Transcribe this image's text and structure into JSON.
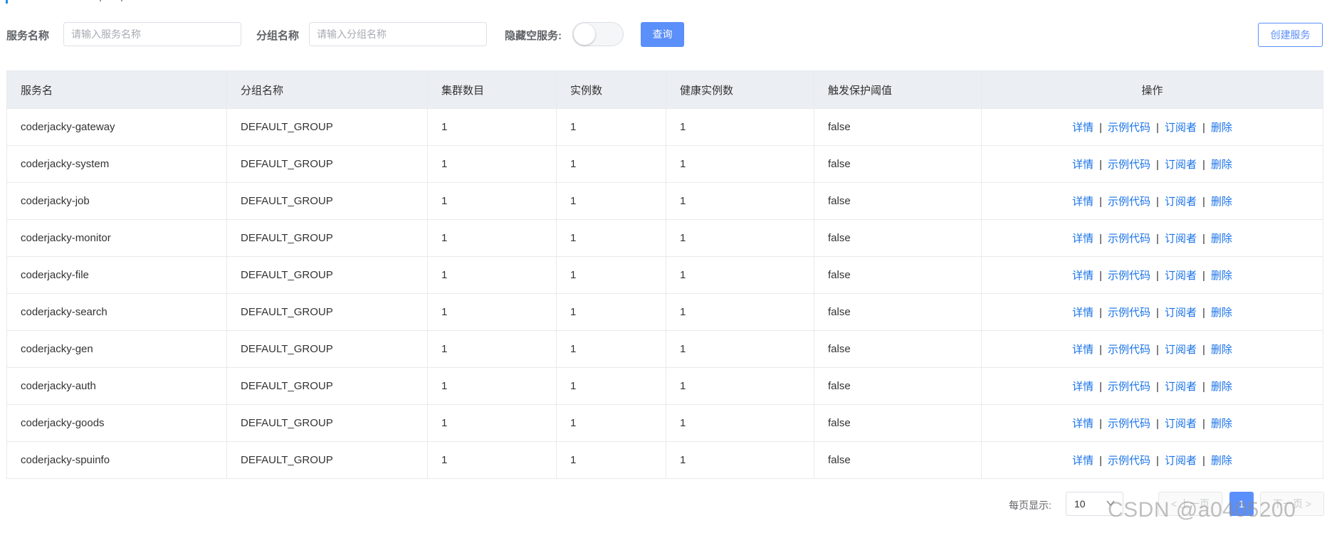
{
  "filters": {
    "service_name_label": "服务名称",
    "service_name_placeholder": "请输入服务名称",
    "group_name_label": "分组名称",
    "group_name_placeholder": "请输入分组名称",
    "hide_empty_label": "隐藏空服务:",
    "hide_empty_on": false,
    "query_button": "查询",
    "create_button": "创建服务"
  },
  "table": {
    "headers": [
      "服务名",
      "分组名称",
      "集群数目",
      "实例数",
      "健康实例数",
      "触发保护阈值",
      "操作"
    ],
    "rows": [
      {
        "service": "coderjacky-gateway",
        "group": "DEFAULT_GROUP",
        "clusters": "1",
        "instances": "1",
        "healthy": "1",
        "threshold": "false"
      },
      {
        "service": "coderjacky-system",
        "group": "DEFAULT_GROUP",
        "clusters": "1",
        "instances": "1",
        "healthy": "1",
        "threshold": "false"
      },
      {
        "service": "coderjacky-job",
        "group": "DEFAULT_GROUP",
        "clusters": "1",
        "instances": "1",
        "healthy": "1",
        "threshold": "false"
      },
      {
        "service": "coderjacky-monitor",
        "group": "DEFAULT_GROUP",
        "clusters": "1",
        "instances": "1",
        "healthy": "1",
        "threshold": "false"
      },
      {
        "service": "coderjacky-file",
        "group": "DEFAULT_GROUP",
        "clusters": "1",
        "instances": "1",
        "healthy": "1",
        "threshold": "false"
      },
      {
        "service": "coderjacky-search",
        "group": "DEFAULT_GROUP",
        "clusters": "1",
        "instances": "1",
        "healthy": "1",
        "threshold": "false"
      },
      {
        "service": "coderjacky-gen",
        "group": "DEFAULT_GROUP",
        "clusters": "1",
        "instances": "1",
        "healthy": "1",
        "threshold": "false"
      },
      {
        "service": "coderjacky-auth",
        "group": "DEFAULT_GROUP",
        "clusters": "1",
        "instances": "1",
        "healthy": "1",
        "threshold": "false"
      },
      {
        "service": "coderjacky-goods",
        "group": "DEFAULT_GROUP",
        "clusters": "1",
        "instances": "1",
        "healthy": "1",
        "threshold": "false"
      },
      {
        "service": "coderjacky-spuinfo",
        "group": "DEFAULT_GROUP",
        "clusters": "1",
        "instances": "1",
        "healthy": "1",
        "threshold": "false"
      }
    ],
    "actions": {
      "detail": "详情",
      "sample_code": "示例代码",
      "subscribers": "订阅者",
      "delete": "删除",
      "separator": "|"
    }
  },
  "pagination": {
    "page_size_label": "每页显示:",
    "page_size": "10",
    "prev": "< 上一页",
    "current_page": "1",
    "next": "下一页 >"
  },
  "watermark": "CSDN @a0405200",
  "colors": {
    "primary": "#5b8ff9",
    "link": "#1a73e8",
    "header_bg": "#ebeef2",
    "border": "#e8eaed"
  }
}
